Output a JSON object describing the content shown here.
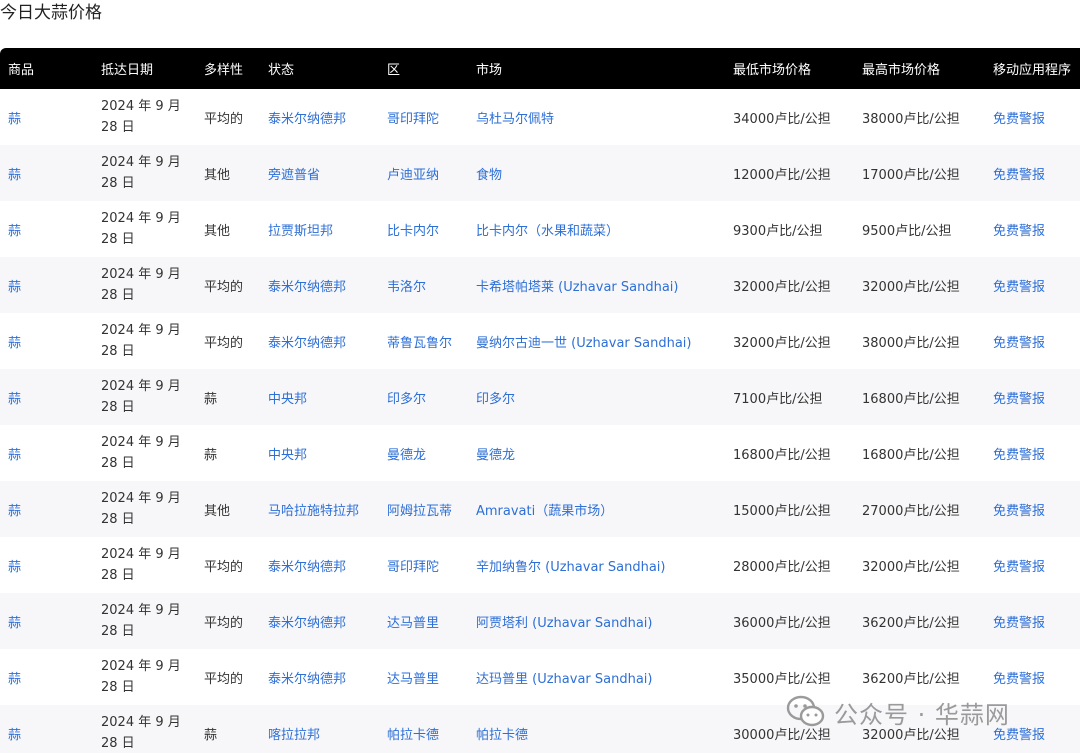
{
  "page": {
    "title": "今日大蒜价格"
  },
  "table": {
    "headers": [
      "商品",
      "抵达日期",
      "多样性",
      "状态",
      "区",
      "市场",
      "最低市场价格",
      "最高市场价格",
      "移动应用程序"
    ],
    "rows": [
      {
        "commodity": "蒜",
        "date": "2024 年 9 月 28 日",
        "variety": "平均的",
        "state": "泰米尔纳德邦",
        "district": "哥印拜陀",
        "market": "乌杜马尔佩特",
        "min_price": "34000卢比/公担",
        "max_price": "38000卢比/公担",
        "app": "免费警报"
      },
      {
        "commodity": "蒜",
        "date": "2024 年 9 月 28 日",
        "variety": "其他",
        "state": "旁遮普省",
        "district": "卢迪亚纳",
        "market": "食物",
        "min_price": "12000卢比/公担",
        "max_price": "17000卢比/公担",
        "app": "免费警报"
      },
      {
        "commodity": "蒜",
        "date": "2024 年 9 月 28 日",
        "variety": "其他",
        "state": "拉贾斯坦邦",
        "district": "比卡内尔",
        "market": "比卡内尔（水果和蔬菜）",
        "min_price": "9300卢比/公担",
        "max_price": "9500卢比/公担",
        "app": "免费警报"
      },
      {
        "commodity": "蒜",
        "date": "2024 年 9 月 28 日",
        "variety": "平均的",
        "state": "泰米尔纳德邦",
        "district": "韦洛尔",
        "market": "卡希塔帕塔莱 (Uzhavar Sandhai)",
        "min_price": "32000卢比/公担",
        "max_price": "32000卢比/公担",
        "app": "免费警报"
      },
      {
        "commodity": "蒜",
        "date": "2024 年 9 月 28 日",
        "variety": "平均的",
        "state": "泰米尔纳德邦",
        "district": "蒂鲁瓦鲁尔",
        "market": "曼纳尔古迪一世 (Uzhavar Sandhai)",
        "min_price": "32000卢比/公担",
        "max_price": "38000卢比/公担",
        "app": "免费警报"
      },
      {
        "commodity": "蒜",
        "date": "2024 年 9 月 28 日",
        "variety": "蒜",
        "state": "中央邦",
        "district": "印多尔",
        "market": "印多尔",
        "min_price": "7100卢比/公担",
        "max_price": "16800卢比/公担",
        "app": "免费警报"
      },
      {
        "commodity": "蒜",
        "date": "2024 年 9 月 28 日",
        "variety": "蒜",
        "state": "中央邦",
        "district": "曼德龙",
        "market": "曼德龙",
        "min_price": "16800卢比/公担",
        "max_price": "16800卢比/公担",
        "app": "免费警报"
      },
      {
        "commodity": "蒜",
        "date": "2024 年 9 月 28 日",
        "variety": "其他",
        "state": "马哈拉施特拉邦",
        "district": "阿姆拉瓦蒂",
        "market": "Amravati（蔬果市场）",
        "min_price": "15000卢比/公担",
        "max_price": "27000卢比/公担",
        "app": "免费警报"
      },
      {
        "commodity": "蒜",
        "date": "2024 年 9 月 28 日",
        "variety": "平均的",
        "state": "泰米尔纳德邦",
        "district": "哥印拜陀",
        "market": "辛加纳鲁尔 (Uzhavar Sandhai)",
        "min_price": "28000卢比/公担",
        "max_price": "32000卢比/公担",
        "app": "免费警报"
      },
      {
        "commodity": "蒜",
        "date": "2024 年 9 月 28 日",
        "variety": "平均的",
        "state": "泰米尔纳德邦",
        "district": "达马普里",
        "market": "阿贾塔利 (Uzhavar Sandhai)",
        "min_price": "36000卢比/公担",
        "max_price": "36200卢比/公担",
        "app": "免费警报"
      },
      {
        "commodity": "蒜",
        "date": "2024 年 9 月 28 日",
        "variety": "平均的",
        "state": "泰米尔纳德邦",
        "district": "达马普里",
        "market": "达玛普里 (Uzhavar Sandhai)",
        "min_price": "35000卢比/公担",
        "max_price": "36200卢比/公担",
        "app": "免费警报"
      },
      {
        "commodity": "蒜",
        "date": "2024 年 9 月 28 日",
        "variety": "蒜",
        "state": "喀拉拉邦",
        "district": "帕拉卡德",
        "market": "帕拉卡德",
        "min_price": "30000卢比/公担",
        "max_price": "32000卢比/公担",
        "app": "免费警报"
      }
    ]
  },
  "watermark": {
    "text": "公众号 · 华蒜网",
    "icon": "wechat-icon"
  }
}
